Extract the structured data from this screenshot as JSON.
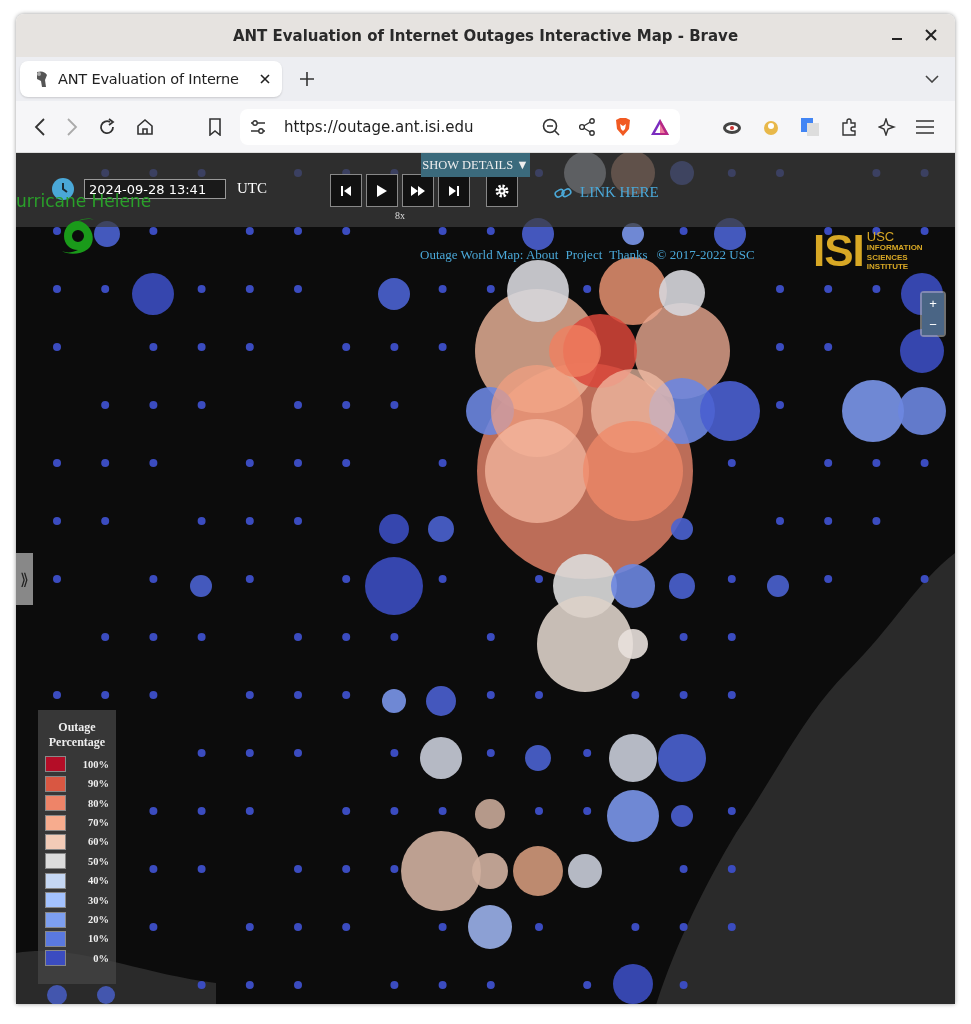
{
  "window": {
    "title": "ANT Evaluation of Internet Outages Interactive Map - Brave"
  },
  "tabs": [
    {
      "label": "ANT Evaluation of Interne",
      "selected": true
    }
  ],
  "toolbar": {
    "url": "https://outage.ant.isi.edu"
  },
  "controls": {
    "datetime": "2024-09-28 13:41",
    "timezone": "UTC",
    "speed": "8x",
    "show_details": "SHOW DETAILS ▼",
    "link": "LINK HERE",
    "event": "urricane Helene"
  },
  "footer_links": [
    {
      "label": "Outage World Map: About"
    },
    {
      "label": "Project"
    },
    {
      "label": "Thanks"
    }
  ],
  "copyright": "© 2017-2022 USC",
  "logo": {
    "mark": "ISI",
    "lines": [
      "USC",
      "INFORMATION",
      "SCIENCES",
      "INSTITUTE"
    ]
  },
  "zoom": {
    "in": "+",
    "out": "−"
  },
  "side_toggle": "⟫",
  "legend": {
    "title": "Outage Percentage",
    "items": [
      {
        "label": "100%",
        "color": "#b40d27"
      },
      {
        "label": "90%",
        "color": "#d95742"
      },
      {
        "label": "80%",
        "color": "#ee8468"
      },
      {
        "label": "70%",
        "color": "#f7ac8e"
      },
      {
        "label": "60%",
        "color": "#f2cbb7"
      },
      {
        "label": "50%",
        "color": "#dcdcdc"
      },
      {
        "label": "40%",
        "color": "#c5d7f3"
      },
      {
        "label": "30%",
        "color": "#a3c2fe"
      },
      {
        "label": "20%",
        "color": "#7d9ff0"
      },
      {
        "label": "10%",
        "color": "#5a79e0"
      },
      {
        "label": "0%",
        "color": "#3b4cc0"
      }
    ]
  }
}
